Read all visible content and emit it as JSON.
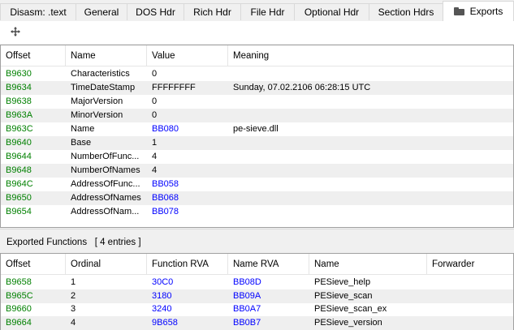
{
  "tabs": [
    "Disasm: .text",
    "General",
    "DOS Hdr",
    "Rich Hdr",
    "File Hdr",
    "Optional Hdr",
    "Section Hdrs",
    "Exports"
  ],
  "active_tab": "Exports",
  "colors": {
    "offset": "#008000",
    "link": "#0000ff",
    "alt_row": "#efefef"
  },
  "export_dir": {
    "columns": [
      "Offset",
      "Name",
      "Value",
      "Meaning"
    ],
    "rows": [
      {
        "offset": "B9630",
        "name": "Characteristics",
        "value": "0",
        "meaning": ""
      },
      {
        "offset": "B9634",
        "name": "TimeDateStamp",
        "value": "FFFFFFFF",
        "meaning": "Sunday, 07.02.2106 06:28:15 UTC"
      },
      {
        "offset": "B9638",
        "name": "MajorVersion",
        "value": "0",
        "meaning": ""
      },
      {
        "offset": "B963A",
        "name": "MinorVersion",
        "value": "0",
        "meaning": ""
      },
      {
        "offset": "B963C",
        "name": "Name",
        "value": "BB080",
        "meaning": "pe-sieve.dll"
      },
      {
        "offset": "B9640",
        "name": "Base",
        "value": "1",
        "meaning": ""
      },
      {
        "offset": "B9644",
        "name": "NumberOfFunc...",
        "value": "4",
        "meaning": ""
      },
      {
        "offset": "B9648",
        "name": "NumberOfNames",
        "value": "4",
        "meaning": ""
      },
      {
        "offset": "B964C",
        "name": "AddressOfFunc...",
        "value": "BB058",
        "meaning": ""
      },
      {
        "offset": "B9650",
        "name": "AddressOfNames",
        "value": "BB068",
        "meaning": ""
      },
      {
        "offset": "B9654",
        "name": "AddressOfNam...",
        "value": "BB078",
        "meaning": ""
      }
    ]
  },
  "exported_functions": {
    "title": "Exported Functions",
    "count_label": "[ 4 entries ]",
    "columns": [
      "Offset",
      "Ordinal",
      "Function RVA",
      "Name RVA",
      "Name",
      "Forwarder"
    ],
    "rows": [
      {
        "offset": "B9658",
        "ordinal": "1",
        "function_rva": "30C0",
        "name_rva": "BB08D",
        "name": "PESieve_help",
        "forwarder": ""
      },
      {
        "offset": "B965C",
        "ordinal": "2",
        "function_rva": "3180",
        "name_rva": "BB09A",
        "name": "PESieve_scan",
        "forwarder": ""
      },
      {
        "offset": "B9660",
        "ordinal": "3",
        "function_rva": "3240",
        "name_rva": "BB0A7",
        "name": "PESieve_scan_ex",
        "forwarder": ""
      },
      {
        "offset": "B9664",
        "ordinal": "4",
        "function_rva": "9B658",
        "name_rva": "BB0B7",
        "name": "PESieve_version",
        "forwarder": ""
      }
    ]
  }
}
